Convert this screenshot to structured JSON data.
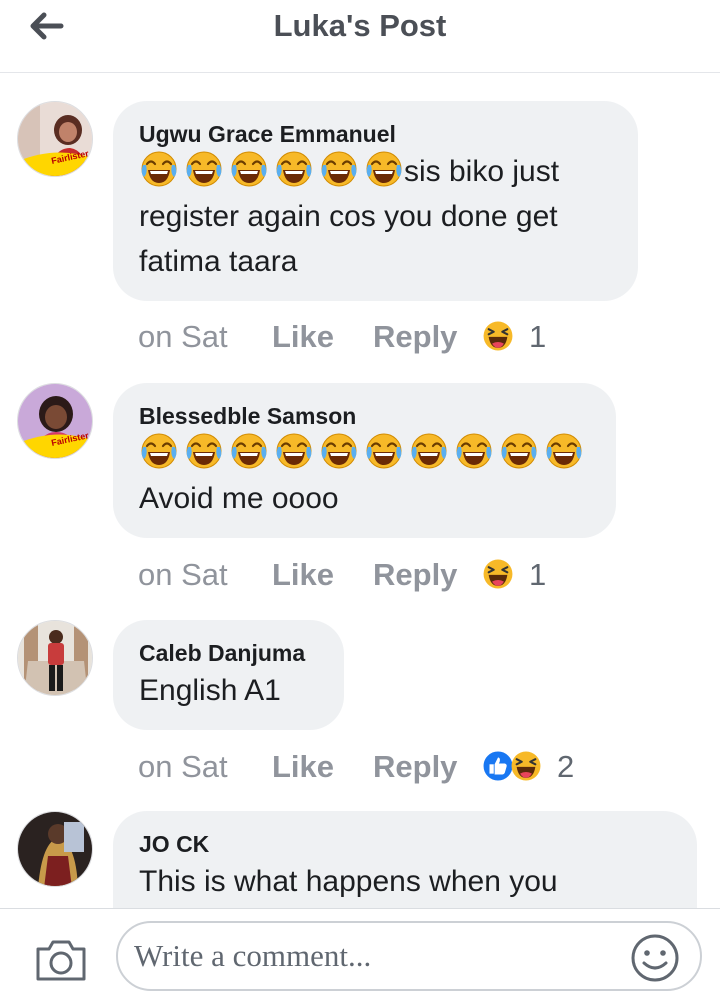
{
  "header": {
    "title": "Luka's Post"
  },
  "comments": [
    {
      "author": "Ugwu Grace Emmanuel",
      "emoji_count": 6,
      "text_line1": "sis biko just",
      "text_line2": "register again cos you done get",
      "text_line3": "fatima taara",
      "time": "on Sat",
      "like": "Like",
      "reply": "Reply",
      "reactions": [
        "haha"
      ],
      "reaction_count": "1"
    },
    {
      "author": "Blessedble Samson",
      "emoji_count": 10,
      "text_line2": "Avoid me oooo",
      "time": "on Sat",
      "like": "Like",
      "reply": "Reply",
      "reactions": [
        "haha"
      ],
      "reaction_count": "1"
    },
    {
      "author": "Caleb Danjuma",
      "text_line1": "English A1",
      "time": "on Sat",
      "like": "Like",
      "reply": "Reply",
      "reactions": [
        "like",
        "haha"
      ],
      "reaction_count": "2"
    },
    {
      "author": "JO CK",
      "text_line1": "This is what happens when you"
    }
  ],
  "composer": {
    "placeholder": "Write a comment..."
  },
  "colors": {
    "like_blue": "#1877f2",
    "emoji_yellow": "#f7b928",
    "tears_blue": "#5aaff0",
    "meta_gray": "#90949c"
  }
}
